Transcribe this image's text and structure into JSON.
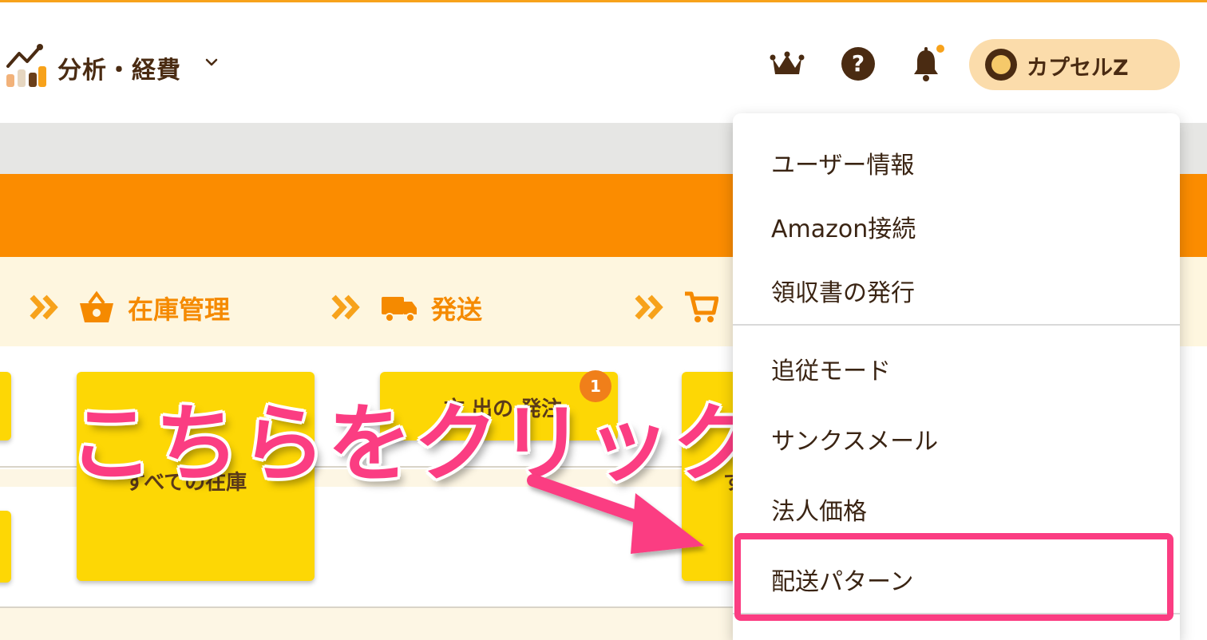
{
  "header": {
    "section_title": "分析・経費",
    "username": "カプセルZ"
  },
  "steps": [
    {
      "label": "在庫管理",
      "icon": "basket-icon"
    },
    {
      "label": "発送",
      "icon": "truck-icon"
    },
    {
      "label": "",
      "icon": "cart-icon"
    }
  ],
  "cards": {
    "all_inventory": "すべての在庫",
    "order_partial": "文  出の 発注",
    "partial_right": "す",
    "badge_count": "1"
  },
  "overlay": {
    "text": "こちらをクリック"
  },
  "menu": {
    "items": [
      "ユーザー情報",
      "Amazon接続",
      "領収書の発行",
      "追従モード",
      "サンクスメール",
      "法人価格",
      "配送パターン"
    ]
  },
  "colors": {
    "accent_orange": "#fb8c00",
    "highlight_pink": "#fb3d82",
    "card_yellow": "#fdd705",
    "brown_text": "#4a2b12"
  }
}
